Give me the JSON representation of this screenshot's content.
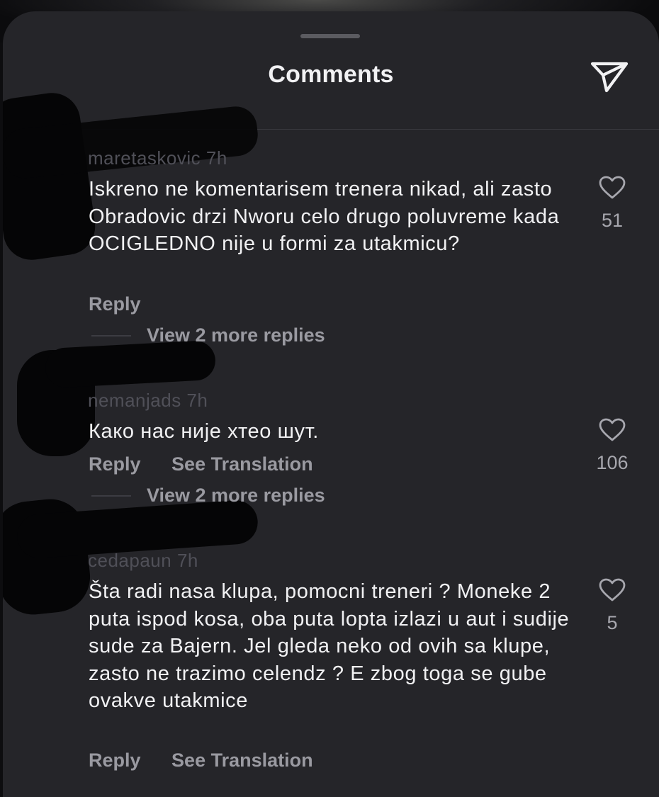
{
  "header": {
    "title": "Comments",
    "share_icon": "paper-plane-icon"
  },
  "comments": [
    {
      "username": "maretaskovic 7h",
      "text": "Iskreno ne komentarisem trenera nikad, ali zasto Obradovic drzi Nworu celo drugo poluvreme kada OCIGLEDNO nije u formi za utakmicu?",
      "reply": "Reply",
      "likes": "51",
      "view_more": "View 2 more replies"
    },
    {
      "username": "nemanjads 7h",
      "text": "Како нас није хтео шут.",
      "reply": "Reply",
      "translate": "See Translation",
      "likes": "106",
      "view_more": "View 2 more replies"
    },
    {
      "username": "cedapaun 7h",
      "text": "Šta radi nasa klupa, pomocni treneri ? Moneke 2 puta ispod kosa, oba puta lopta izlazi u aut i sudije sude za Bajern. Jel gleda neko od ovih sa klupe, zasto ne trazimo celendz ? E zbog toga se gube ovakve utakmice",
      "reply": "Reply",
      "translate": "See Translation",
      "likes": "5"
    }
  ],
  "colors": {
    "sheet": "#252529",
    "text": "#f1f1f3",
    "muted": "#9a9aa1",
    "redaction": "#050506"
  }
}
